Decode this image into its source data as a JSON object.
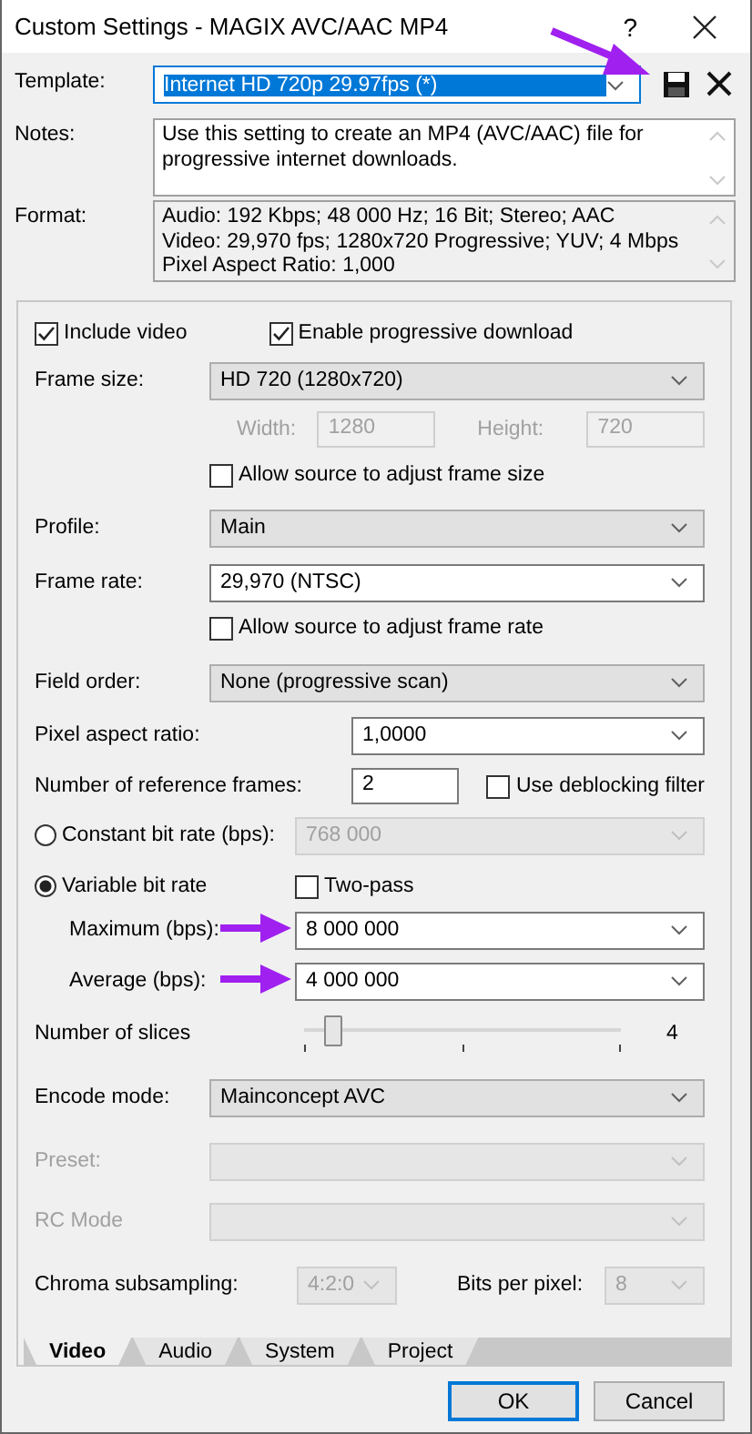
{
  "window": {
    "title": "Custom Settings - MAGIX AVC/AAC MP4",
    "help": "?"
  },
  "template": {
    "label": "Template:",
    "value": "Internet HD 720p 29.97fps (*)",
    "text_selected": true
  },
  "notes": {
    "label": "Notes:",
    "value": "Use this setting to create an MP4 (AVC/AAC) file for progressive internet downloads."
  },
  "format": {
    "label": "Format:",
    "lines": [
      "Audio: 192 Kbps; 48 000 Hz; 16 Bit; Stereo; AAC",
      "Video: 29,970 fps; 1280x720 Progressive; YUV; 4 Mbps",
      "Pixel Aspect Ratio: 1,000"
    ]
  },
  "video": {
    "include_video": {
      "label": "Include video",
      "checked": true
    },
    "progressive": {
      "label": "Enable progressive download",
      "checked": true
    },
    "frame_size": {
      "label": "Frame size:",
      "value": "HD 720 (1280x720)",
      "editable": false,
      "disabled": false
    },
    "width": {
      "label": "Width:",
      "value": "1280",
      "disabled": true
    },
    "height": {
      "label": "Height:",
      "value": "720",
      "disabled": true
    },
    "adjust_size": {
      "label": "Allow source to adjust frame size",
      "checked": false
    },
    "profile": {
      "label": "Profile:",
      "value": "Main",
      "editable": false,
      "disabled": false
    },
    "frame_rate": {
      "label": "Frame rate:",
      "value": "29,970 (NTSC)",
      "editable": true,
      "disabled": false
    },
    "adjust_rate": {
      "label": "Allow source to adjust frame rate",
      "checked": false
    },
    "field_order": {
      "label": "Field order:",
      "value": "None (progressive scan)",
      "editable": false,
      "disabled": false
    },
    "pixel_aspect": {
      "label": "Pixel aspect ratio:",
      "value": "1,0000",
      "editable": true,
      "disabled": false
    },
    "ref_frames": {
      "label": "Number of reference frames:",
      "value": "2",
      "disabled": false
    },
    "deblocking": {
      "label": "Use deblocking filter",
      "checked": false
    },
    "bitrate_modes": [
      {
        "label": "Constant bit rate (bps):",
        "selected": false
      },
      {
        "label": "Variable bit rate",
        "selected": true
      }
    ],
    "constant_rate": {
      "value": "768 000",
      "disabled": true
    },
    "two_pass": {
      "label": "Two-pass",
      "checked": false
    },
    "maximum": {
      "label": "Maximum (bps):",
      "value": "8 000 000",
      "editable": true,
      "disabled": false
    },
    "average": {
      "label": "Average (bps):",
      "value": "4 000 000",
      "editable": true,
      "disabled": false
    },
    "slices": {
      "label": "Number of slices",
      "level": 0.09,
      "reading": "4"
    },
    "encode_mode": {
      "label": "Encode mode:",
      "value": "Mainconcept AVC",
      "editable": false,
      "disabled": false
    },
    "preset": {
      "label": "Preset:",
      "disabled": true
    },
    "rc_mode": {
      "label": "RC Mode",
      "disabled": true
    },
    "chroma": {
      "label": "Chroma subsampling:",
      "value": "4:2:0",
      "disabled": true
    },
    "bits": {
      "label": "Bits per pixel:",
      "value": "8",
      "disabled": true
    }
  },
  "tabs": [
    {
      "label": "Video",
      "selected": true
    },
    {
      "label": "Audio",
      "selected": false
    },
    {
      "label": "System",
      "selected": false
    },
    {
      "label": "Project",
      "selected": false
    }
  ],
  "buttons": [
    {
      "label": "OK",
      "default": true
    },
    {
      "label": "Cancel",
      "default": false
    }
  ]
}
